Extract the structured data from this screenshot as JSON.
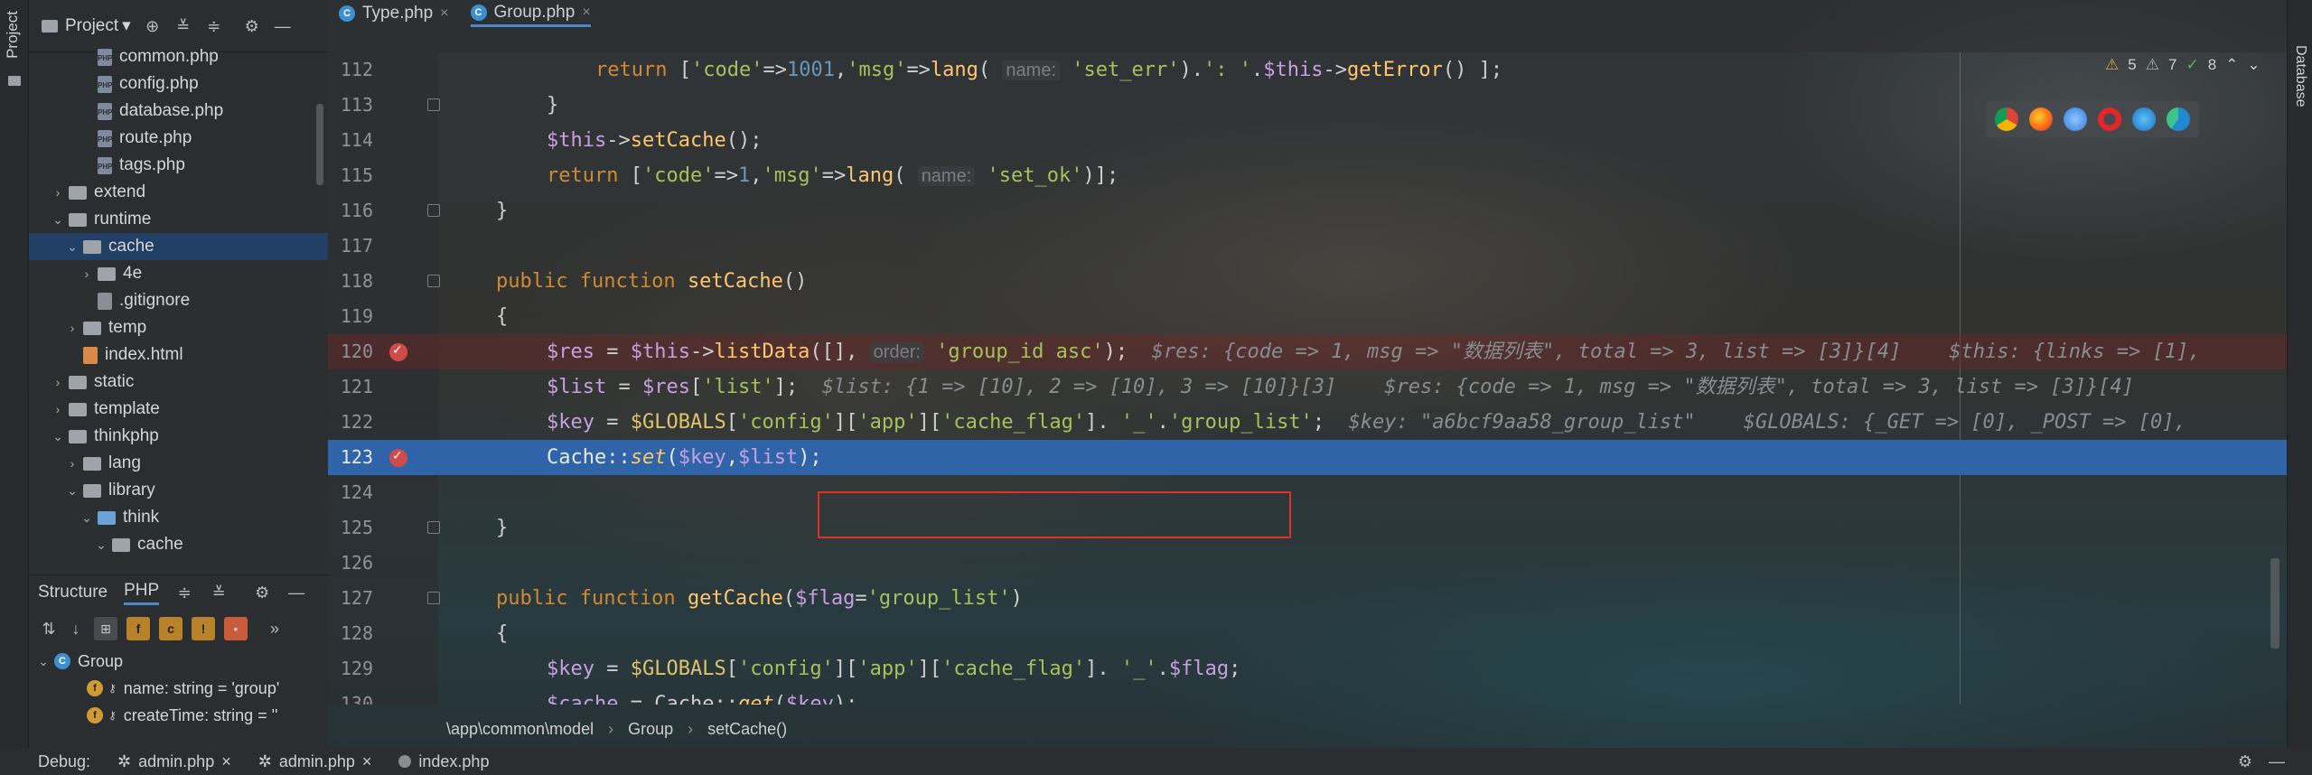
{
  "left_strip": {
    "tab_label": "Project"
  },
  "right_strip": {
    "tab_label": "Database"
  },
  "project_panel": {
    "title": "Project",
    "toolbar_icons": [
      "target-icon",
      "collapse-all-icon",
      "expand-all-icon",
      "gear-icon",
      "minimize-icon"
    ],
    "tree": [
      {
        "label": "common.php",
        "type": "php-file",
        "depth": 3
      },
      {
        "label": "config.php",
        "type": "php-file",
        "depth": 3
      },
      {
        "label": "database.php",
        "type": "php-file",
        "depth": 3
      },
      {
        "label": "route.php",
        "type": "php-file",
        "depth": 3
      },
      {
        "label": "tags.php",
        "type": "php-file",
        "depth": 3
      },
      {
        "label": "extend",
        "type": "folder",
        "depth": 1,
        "expanded": false
      },
      {
        "label": "runtime",
        "type": "folder",
        "depth": 1,
        "expanded": true
      },
      {
        "label": "cache",
        "type": "folder",
        "depth": 2,
        "expanded": true,
        "selected": true
      },
      {
        "label": "4e",
        "type": "folder",
        "depth": 3,
        "expanded": false
      },
      {
        "label": ".gitignore",
        "type": "git-file",
        "depth": 3
      },
      {
        "label": "temp",
        "type": "folder",
        "depth": 2,
        "expanded": false
      },
      {
        "label": "index.html",
        "type": "html-file",
        "depth": 2
      },
      {
        "label": "static",
        "type": "folder",
        "depth": 1,
        "expanded": false
      },
      {
        "label": "template",
        "type": "folder",
        "depth": 1,
        "expanded": false
      },
      {
        "label": "thinkphp",
        "type": "folder",
        "depth": 1,
        "expanded": true
      },
      {
        "label": "lang",
        "type": "folder",
        "depth": 2,
        "expanded": false
      },
      {
        "label": "library",
        "type": "folder",
        "depth": 2,
        "expanded": true
      },
      {
        "label": "think",
        "type": "folder-blue",
        "depth": 3,
        "expanded": true
      },
      {
        "label": "cache",
        "type": "folder",
        "depth": 4,
        "expanded": true
      }
    ]
  },
  "structure_panel": {
    "tabs": [
      "Structure",
      "PHP"
    ],
    "active_tab": "PHP",
    "class_name": "Group",
    "fields": [
      "name: string = 'group'",
      "createTime: string = ''"
    ]
  },
  "tabs": [
    {
      "label": "Type.php",
      "active": false
    },
    {
      "label": "Group.php",
      "active": true
    }
  ],
  "inspections": {
    "warnings": "5",
    "weak_warnings": "7",
    "ok": "8"
  },
  "code_lines": [
    {
      "num": "112"
    },
    {
      "num": "113"
    },
    {
      "num": "114"
    },
    {
      "num": "115"
    },
    {
      "num": "116"
    },
    {
      "num": "117"
    },
    {
      "num": "118"
    },
    {
      "num": "119"
    },
    {
      "num": "120"
    },
    {
      "num": "121"
    },
    {
      "num": "122"
    },
    {
      "num": "123"
    },
    {
      "num": "124"
    },
    {
      "num": "125"
    },
    {
      "num": "126"
    },
    {
      "num": "127"
    },
    {
      "num": "128"
    },
    {
      "num": "129"
    },
    {
      "num": "130"
    }
  ],
  "code": {
    "l112_hint": "name:",
    "l115_hint": "name:",
    "l120_hint": "order:",
    "l120_inline": "$res: {code => 1, msg => \"数据列表\", total => 3, list => [3]}[4]    $this: {links => [1],",
    "l121_inline": "$list: {1 => [10], 2 => [10], 3 => [10]}[3]    $res: {code => 1, msg => \"数据列表\", total => 3, list => [3]}[4]",
    "l122_inline": "$key: \"a6bcf9aa58_group_list\"    $GLOBALS: {_GET => [0], _POST => [0],"
  },
  "breadcrumb": [
    "\\app\\common\\model",
    "Group",
    "setCache()"
  ],
  "debug_bar": {
    "label": "Debug:",
    "tabs": [
      "admin.php",
      "admin.php",
      "index.php"
    ]
  },
  "colors": {
    "selection": "#2f65a8",
    "error_line": "#6e2828",
    "accent": "#4a88c7",
    "red_box": "#e0302a"
  }
}
